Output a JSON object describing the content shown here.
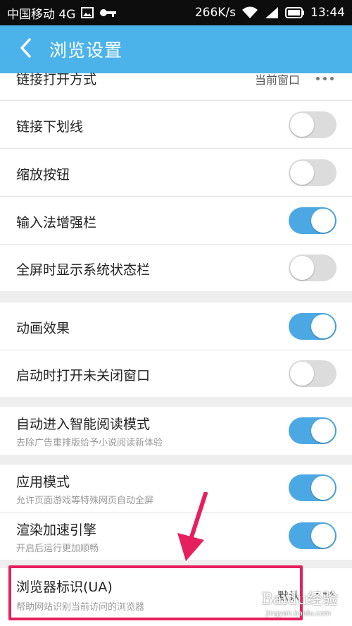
{
  "status_bar": {
    "carrier": "中国移动 4G",
    "speed": "266K/s",
    "time": "13:44",
    "icons": [
      "image-icon",
      "key-icon",
      "wifi-icon",
      "signal-icon",
      "battery-icon"
    ]
  },
  "header": {
    "title": "浏览设置",
    "back_icon": "back-arrow-icon"
  },
  "settings": {
    "link_open_mode": {
      "label": "链接打开方式",
      "value": "当前窗口"
    },
    "link_underline": {
      "label": "链接下划线",
      "enabled": false
    },
    "zoom_buttons": {
      "label": "缩放按钮",
      "enabled": false
    },
    "ime_toolbar": {
      "label": "输入法增强栏",
      "enabled": true
    },
    "fullscreen_status_bar": {
      "label": "全屏时显示系统状态栏",
      "enabled": false
    },
    "animation": {
      "label": "动画效果",
      "enabled": true
    },
    "restore_windows": {
      "label": "启动时打开未关闭窗口",
      "enabled": false
    },
    "smart_reading": {
      "label": "自动进入智能阅读模式",
      "sub": "去除广告重排版给予小说阅读新体验",
      "enabled": true
    },
    "app_mode": {
      "label": "应用模式",
      "sub": "允许页面游戏等特殊网页自动全屏",
      "enabled": true
    },
    "render_accel": {
      "label": "渲染加速引擎",
      "sub": "开启后运行更加顺畅",
      "enabled": true
    },
    "user_agent": {
      "label": "浏览器标识(UA)",
      "sub": "帮助网站识别当前访问的浏览器",
      "value": "默认"
    }
  },
  "annotation": {
    "color": "#e6205e"
  },
  "watermark": {
    "text": "Baidu经验",
    "url": "jingyan.baidu.com"
  },
  "colors": {
    "accent": "#4cb3ea",
    "toggle_on": "#4ca8e3",
    "toggle_off": "#dcdcdc"
  }
}
